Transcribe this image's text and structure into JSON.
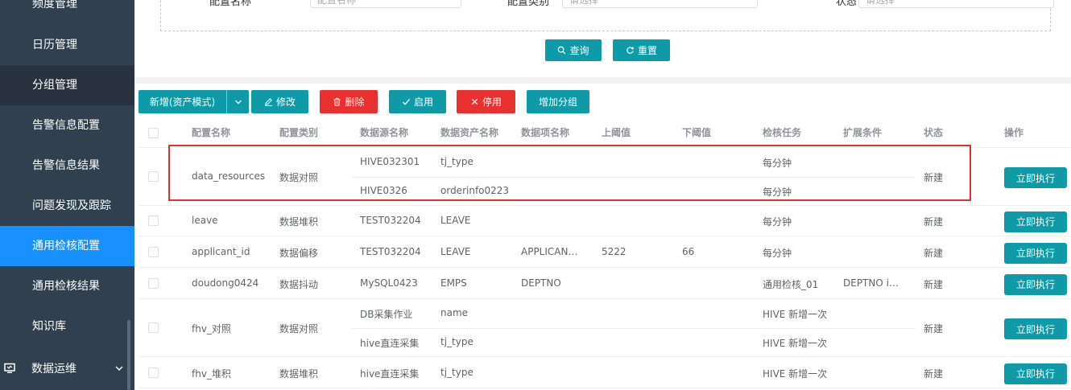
{
  "sidebar": {
    "items": [
      {
        "label": "频度管理"
      },
      {
        "label": "日历管理"
      },
      {
        "label": "分组管理"
      },
      {
        "label": "告警信息配置"
      },
      {
        "label": "告警信息结果"
      },
      {
        "label": "问题发现及跟踪"
      },
      {
        "label": "通用检核配置"
      },
      {
        "label": "通用检核结果"
      },
      {
        "label": "知识库"
      }
    ],
    "parent": {
      "label": "数据运维",
      "icon": "monitor-icon"
    }
  },
  "search": {
    "field1_label": "配置名称",
    "field1_placeholder": "配置名称",
    "field2_label": "配置类别",
    "field2_placeholder": "请选择",
    "field3_label": "状态",
    "field3_placeholder": "请选择",
    "query_label": "查询",
    "reset_label": "重置"
  },
  "toolbar": {
    "add_label": "新增(资产模式)",
    "edit_label": "修改",
    "delete_label": "删除",
    "enable_label": "启用",
    "disable_label": "停用",
    "add_group_label": "增加分组"
  },
  "table": {
    "headers": [
      "配置名称",
      "配置类别",
      "数据源名称",
      "数据资产名称",
      "数据项名称",
      "上阈值",
      "下阈值",
      "检核任务",
      "扩展条件",
      "状态",
      "操作"
    ],
    "exec_label": "立即执行",
    "rows": [
      {
        "name": "data_resources",
        "category": "数据对照",
        "status": "新建",
        "subs": [
          {
            "source": "HIVE032301",
            "asset": "tj_type",
            "item": "",
            "upper": "",
            "lower": "",
            "task": "每分钟",
            "ext": ""
          },
          {
            "source": "HIVE0326",
            "asset": "orderinfo0223",
            "item": "",
            "upper": "",
            "lower": "",
            "task": "每分钟",
            "ext": ""
          }
        ]
      },
      {
        "name": "leave",
        "category": "数据堆积",
        "status": "新建",
        "subs": [
          {
            "source": "TEST032204",
            "asset": "LEAVE",
            "item": "",
            "upper": "",
            "lower": "",
            "task": "每分钟",
            "ext": ""
          }
        ]
      },
      {
        "name": "applicant_id",
        "category": "数据偏移",
        "status": "新建",
        "subs": [
          {
            "source": "TEST032204",
            "asset": "LEAVE",
            "item": "APPLICANT_ID",
            "upper": "5222",
            "lower": "66",
            "task": "每分钟",
            "ext": ""
          }
        ]
      },
      {
        "name": "doudong0424",
        "category": "数据抖动",
        "status": "新建",
        "subs": [
          {
            "source": "MySQL0423",
            "asset": "EMPS",
            "item": "DEPTNO",
            "upper": "",
            "lower": "",
            "task": "通用检核_01",
            "ext": "DEPTNO is not null"
          }
        ]
      },
      {
        "name": "fhv_对照",
        "category": "数据对照",
        "status": "新建",
        "subs": [
          {
            "source": "DB采集作业",
            "asset": "name",
            "item": "",
            "upper": "",
            "lower": "",
            "task": "HIVE 新增一次",
            "ext": ""
          },
          {
            "source": "hive直连采集",
            "asset": "tj_type",
            "item": "",
            "upper": "",
            "lower": "",
            "task": "HIVE 新增一次",
            "ext": ""
          }
        ]
      },
      {
        "name": "fhv_堆积",
        "category": "数据堆积",
        "status": "新建",
        "subs": [
          {
            "source": "hive直连采集",
            "asset": "tj_type",
            "item": "",
            "upper": "",
            "lower": "",
            "task": "HIVE 新增一次",
            "ext": ""
          }
        ]
      }
    ]
  }
}
